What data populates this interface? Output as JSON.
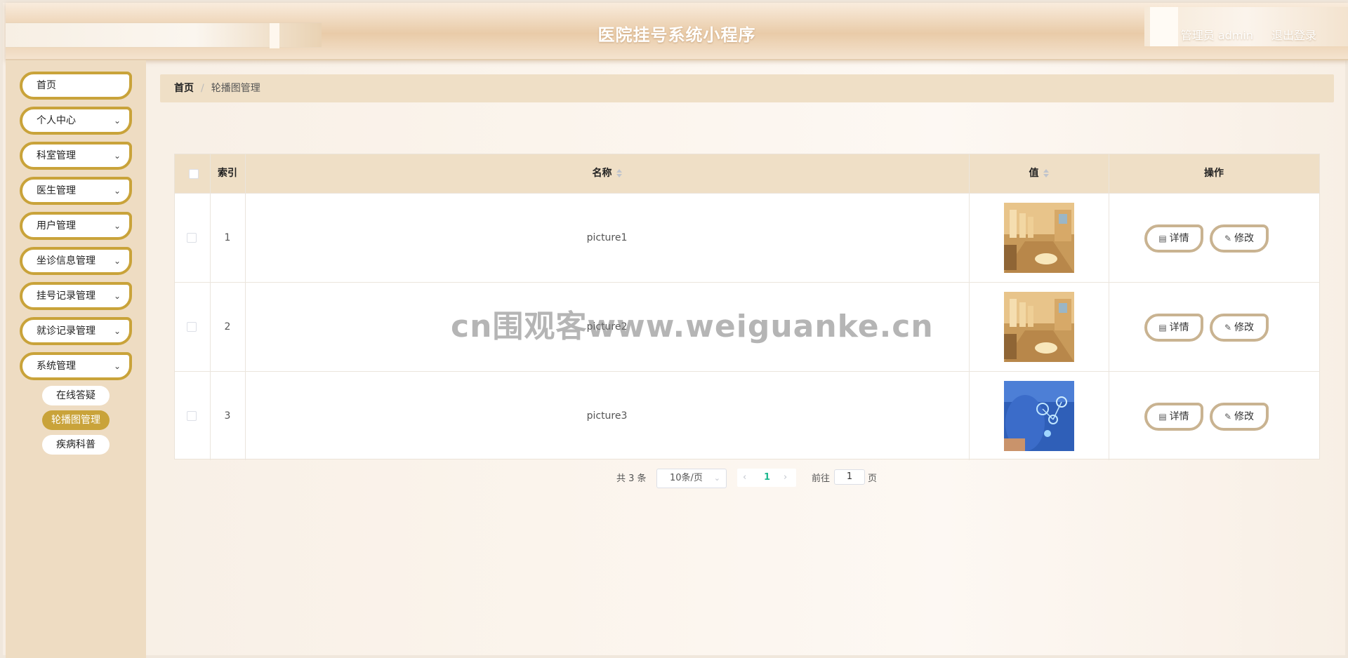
{
  "header": {
    "title": "医院挂号系统小程序",
    "user": "管理员 admin",
    "logout": "退出登录"
  },
  "sidebar": {
    "items": [
      {
        "label": "首页",
        "expandable": false
      },
      {
        "label": "个人中心",
        "expandable": true
      },
      {
        "label": "科室管理",
        "expandable": true
      },
      {
        "label": "医生管理",
        "expandable": true
      },
      {
        "label": "用户管理",
        "expandable": true
      },
      {
        "label": "坐诊信息管理",
        "expandable": true
      },
      {
        "label": "挂号记录管理",
        "expandable": true
      },
      {
        "label": "就诊记录管理",
        "expandable": true
      },
      {
        "label": "系统管理",
        "expandable": true
      }
    ],
    "sub_items": [
      {
        "label": "在线答疑",
        "active": false
      },
      {
        "label": "轮播图管理",
        "active": true
      },
      {
        "label": "疾病科普",
        "active": false
      }
    ],
    "chevron": "chevron-down-icon"
  },
  "breadcrumb": {
    "home": "首页",
    "separator": "/",
    "current": "轮播图管理"
  },
  "table": {
    "headers": {
      "index": "索引",
      "name": "名称",
      "value": "值",
      "actions": "操作"
    },
    "rows": [
      {
        "index": "1",
        "name": "picture1",
        "image": "hospital-corridor"
      },
      {
        "index": "2",
        "name": "picture2",
        "image": "hospital-corridor"
      },
      {
        "index": "3",
        "name": "picture3",
        "image": "medical-tech-blue"
      }
    ],
    "detail_label": "详情",
    "edit_label": "修改"
  },
  "pagination": {
    "total": "共 3 条",
    "page_size": "10条/页",
    "current_page": "1",
    "goto_label": "前往",
    "goto_value": "1",
    "page_suffix": "页"
  },
  "watermark": "cn围观客www.weiguanke.cn",
  "colors": {
    "accent": "#c9a33a",
    "sidebar_bg": "#eedcc2",
    "table_header_bg": "#efdfc6",
    "button_border": "#c9b391",
    "active_page": "#1fb88f"
  }
}
